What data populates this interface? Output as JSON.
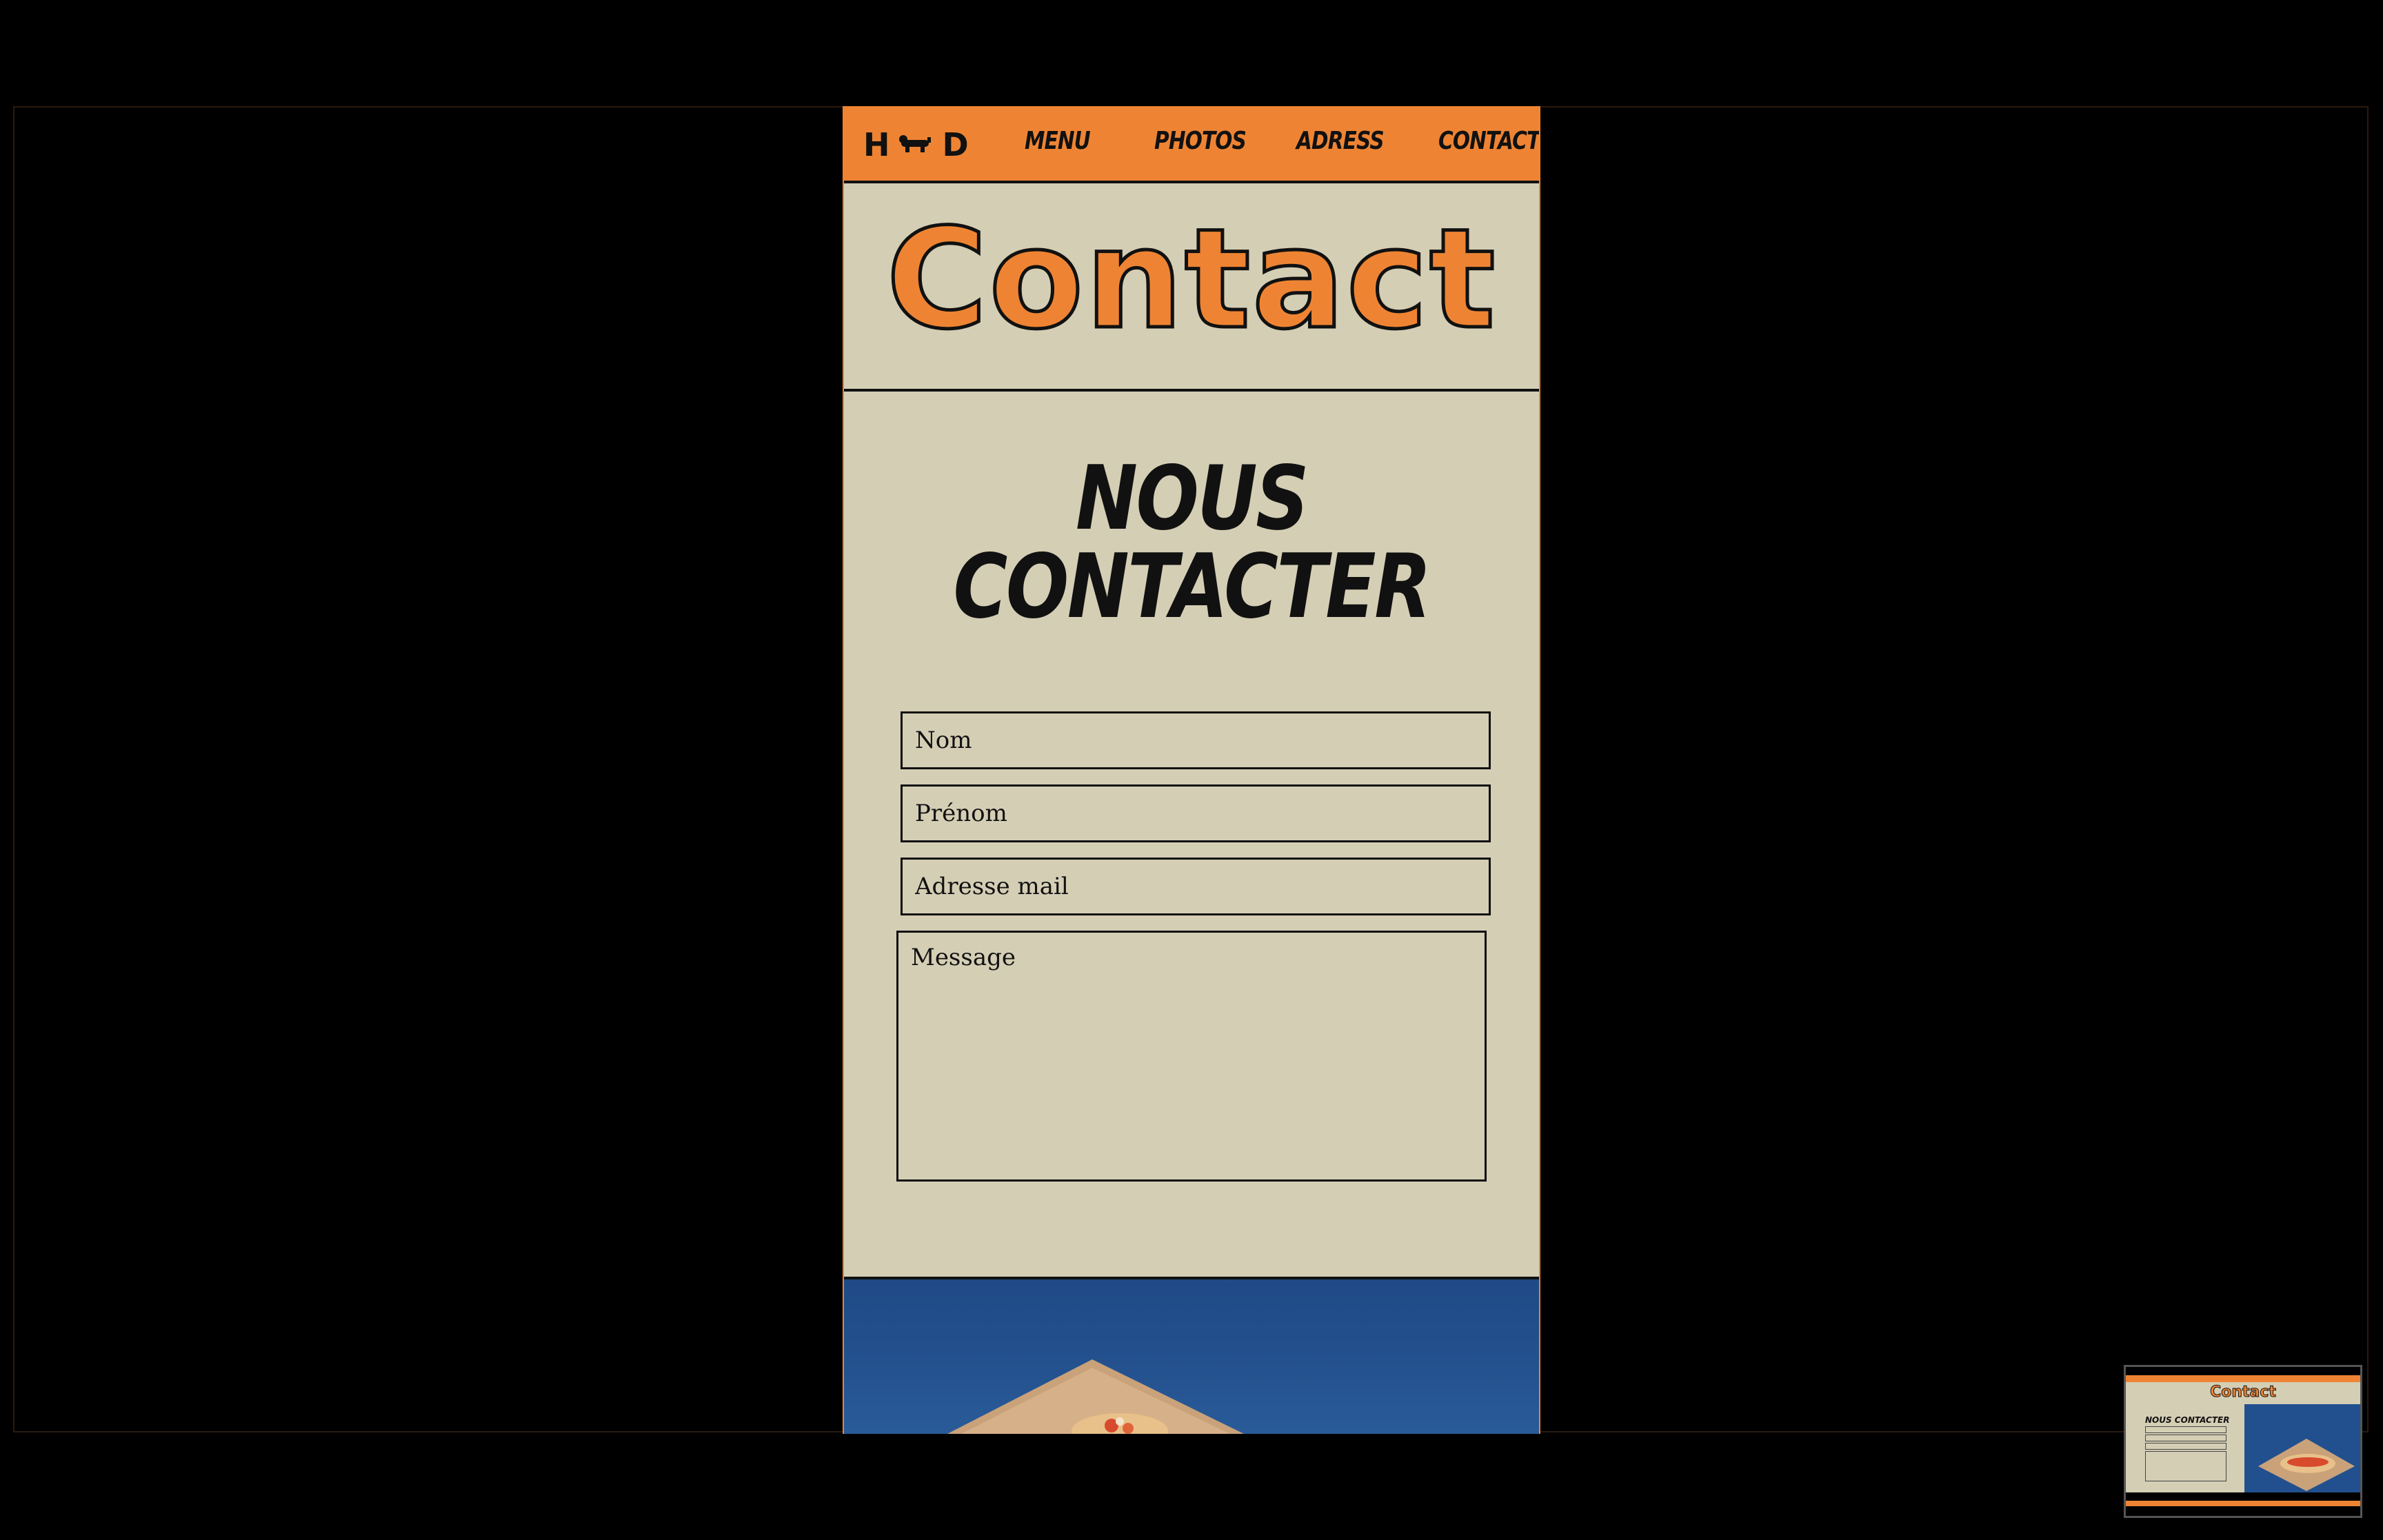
{
  "nav": {
    "logo_left": "H",
    "logo_right": "D",
    "logo_icon": "dog-icon",
    "items": [
      {
        "label": "MENU"
      },
      {
        "label": "PHOTOS"
      },
      {
        "label": "ADRESS"
      },
      {
        "label": "CONTACT"
      }
    ]
  },
  "hero": {
    "title": "Contact"
  },
  "form": {
    "heading": "NOUS CONTACTER",
    "fields": {
      "nom": {
        "placeholder": "Nom",
        "value": ""
      },
      "prenom": {
        "placeholder": "Prénom",
        "value": ""
      },
      "mail": {
        "placeholder": "Adresse mail",
        "value": ""
      },
      "message": {
        "placeholder": "Message",
        "value": ""
      }
    }
  },
  "minimap": {
    "title": "Contact",
    "heading": "NOUS CONTACTER"
  },
  "colors": {
    "accent": "#ee8433",
    "background": "#d4ceb5",
    "ink": "#111111",
    "photo_blue": "#22508e"
  }
}
